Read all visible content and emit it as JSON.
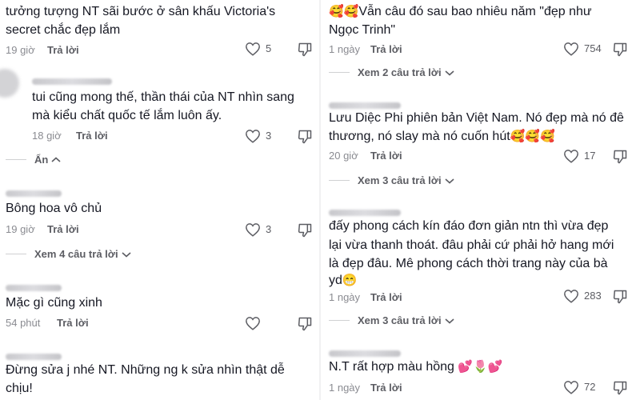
{
  "left": {
    "c1": {
      "text": [
        "tưởng tượng NT sãi bước ở sân khấu Victoria's",
        "secret chắc đẹp lắm"
      ],
      "time": "19 giờ",
      "reply": "Trả lời",
      "likes": "5"
    },
    "c2": {
      "text": [
        "tui cũng mong thế, thần thái của NT nhìn sang",
        "mà kiểu chất quốc tế lắm luôn ấy."
      ],
      "time": "18 giờ",
      "reply": "Trả lời",
      "likes": "3",
      "collapse": "Ẩn"
    },
    "c3": {
      "text": [
        "Bông hoa vô chủ"
      ],
      "time": "19 giờ",
      "reply": "Trả lời",
      "likes": "3",
      "view_replies": "Xem 4 câu trả lời"
    },
    "c4": {
      "text": [
        "Mặc gì cũng xinh"
      ],
      "time": "54 phút",
      "reply": "Trả lời"
    },
    "c5": {
      "text": [
        "Đừng sửa j nhé NT. Những ng k sửa nhìn thật dễ",
        "chịu!"
      ]
    }
  },
  "right": {
    "c1": {
      "text": [
        "Vẫn câu đó sau bao nhiêu năm \"đẹp như",
        "Ngọc Trinh\""
      ],
      "emoji": "🥰🥰",
      "time": "1 ngày",
      "reply": "Trả lời",
      "likes": "754",
      "view_replies": "Xem 2 câu trả lời"
    },
    "c2": {
      "text": [
        "Lưu Diệc Phi phiên bản Việt Nam. Nó đẹp mà nó đê",
        "thương, nó slay mà nó cuốn hút"
      ],
      "emoji": "🥰🥰🥰",
      "time": "20 giờ",
      "reply": "Trả lời",
      "likes": "17",
      "view_replies": "Xem 3 câu trả lời"
    },
    "c3": {
      "text": [
        "đấy phong cách kín đáo đơn giản ntn thì vừa đẹp",
        "lại vừa thanh thoát. đâu phải cứ phải hở hang mới",
        "là đẹp đâu. Mê phong cách thời trang này của bà",
        "yd"
      ],
      "emoji": "😁",
      "time": "1 ngày",
      "reply": "Trả lời",
      "likes": "283",
      "view_replies": "Xem 3 câu trả lời"
    },
    "c4": {
      "text": [
        "N.T rất hợp màu hồng"
      ],
      "emoji": "💕🌷💕",
      "time": "1 ngày",
      "reply": "Trả lời",
      "likes": "72"
    }
  },
  "icons": {
    "heart": "heart-outline-icon",
    "dislike": "thumbs-down-icon",
    "chevron": "chevron-down-icon",
    "chevron_up": "chevron-up-icon"
  },
  "colors": {
    "text": "#161823",
    "meta": "#8a8b91",
    "action": "#5c5d63"
  }
}
